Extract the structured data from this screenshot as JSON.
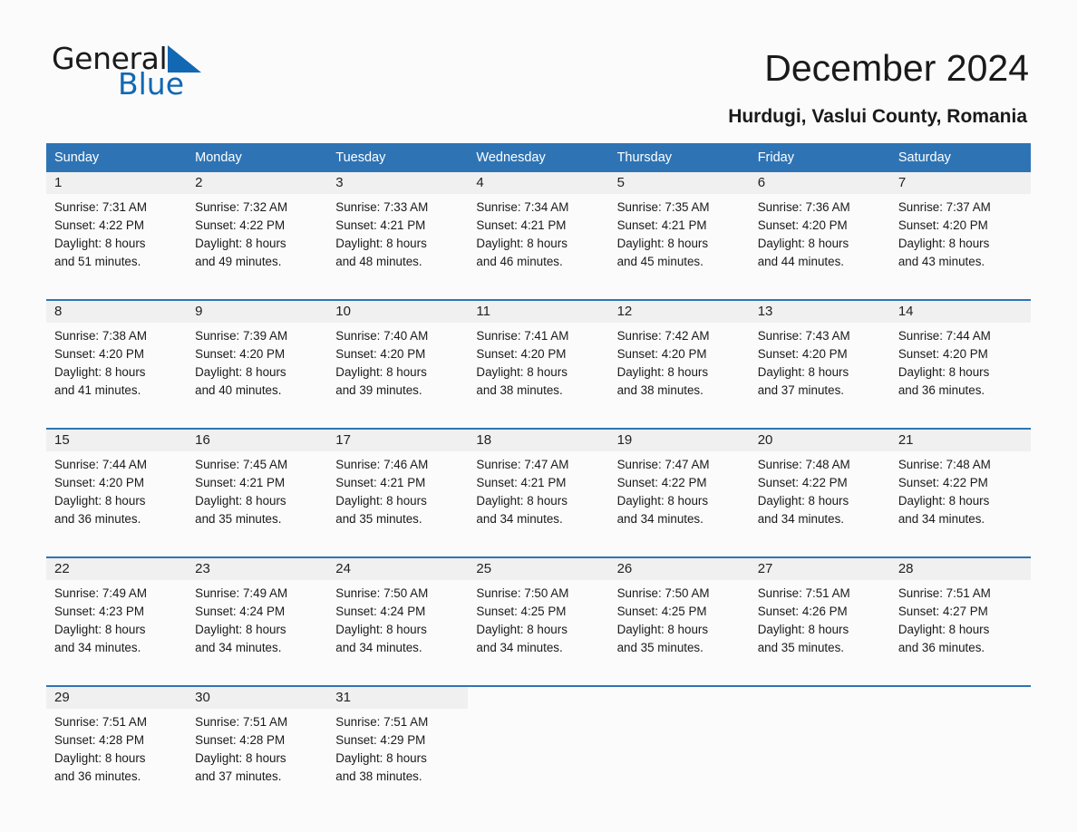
{
  "brand": {
    "name_part1": "General",
    "name_part2": "Blue",
    "triangle_color": "#1268b3"
  },
  "header": {
    "title": "December 2024",
    "location": "Hurdugi, Vaslui County, Romania",
    "header_bg_color": "#2e74b5",
    "daynum_bg_color": "#f0f0f0"
  },
  "calendar": {
    "weekday_headers": [
      "Sunday",
      "Monday",
      "Tuesday",
      "Wednesday",
      "Thursday",
      "Friday",
      "Saturday"
    ],
    "weeks": [
      [
        {
          "day": "1",
          "sunrise": "Sunrise: 7:31 AM",
          "sunset": "Sunset: 4:22 PM",
          "daylight1": "Daylight: 8 hours",
          "daylight2": "and 51 minutes."
        },
        {
          "day": "2",
          "sunrise": "Sunrise: 7:32 AM",
          "sunset": "Sunset: 4:22 PM",
          "daylight1": "Daylight: 8 hours",
          "daylight2": "and 49 minutes."
        },
        {
          "day": "3",
          "sunrise": "Sunrise: 7:33 AM",
          "sunset": "Sunset: 4:21 PM",
          "daylight1": "Daylight: 8 hours",
          "daylight2": "and 48 minutes."
        },
        {
          "day": "4",
          "sunrise": "Sunrise: 7:34 AM",
          "sunset": "Sunset: 4:21 PM",
          "daylight1": "Daylight: 8 hours",
          "daylight2": "and 46 minutes."
        },
        {
          "day": "5",
          "sunrise": "Sunrise: 7:35 AM",
          "sunset": "Sunset: 4:21 PM",
          "daylight1": "Daylight: 8 hours",
          "daylight2": "and 45 minutes."
        },
        {
          "day": "6",
          "sunrise": "Sunrise: 7:36 AM",
          "sunset": "Sunset: 4:20 PM",
          "daylight1": "Daylight: 8 hours",
          "daylight2": "and 44 minutes."
        },
        {
          "day": "7",
          "sunrise": "Sunrise: 7:37 AM",
          "sunset": "Sunset: 4:20 PM",
          "daylight1": "Daylight: 8 hours",
          "daylight2": "and 43 minutes."
        }
      ],
      [
        {
          "day": "8",
          "sunrise": "Sunrise: 7:38 AM",
          "sunset": "Sunset: 4:20 PM",
          "daylight1": "Daylight: 8 hours",
          "daylight2": "and 41 minutes."
        },
        {
          "day": "9",
          "sunrise": "Sunrise: 7:39 AM",
          "sunset": "Sunset: 4:20 PM",
          "daylight1": "Daylight: 8 hours",
          "daylight2": "and 40 minutes."
        },
        {
          "day": "10",
          "sunrise": "Sunrise: 7:40 AM",
          "sunset": "Sunset: 4:20 PM",
          "daylight1": "Daylight: 8 hours",
          "daylight2": "and 39 minutes."
        },
        {
          "day": "11",
          "sunrise": "Sunrise: 7:41 AM",
          "sunset": "Sunset: 4:20 PM",
          "daylight1": "Daylight: 8 hours",
          "daylight2": "and 38 minutes."
        },
        {
          "day": "12",
          "sunrise": "Sunrise: 7:42 AM",
          "sunset": "Sunset: 4:20 PM",
          "daylight1": "Daylight: 8 hours",
          "daylight2": "and 38 minutes."
        },
        {
          "day": "13",
          "sunrise": "Sunrise: 7:43 AM",
          "sunset": "Sunset: 4:20 PM",
          "daylight1": "Daylight: 8 hours",
          "daylight2": "and 37 minutes."
        },
        {
          "day": "14",
          "sunrise": "Sunrise: 7:44 AM",
          "sunset": "Sunset: 4:20 PM",
          "daylight1": "Daylight: 8 hours",
          "daylight2": "and 36 minutes."
        }
      ],
      [
        {
          "day": "15",
          "sunrise": "Sunrise: 7:44 AM",
          "sunset": "Sunset: 4:20 PM",
          "daylight1": "Daylight: 8 hours",
          "daylight2": "and 36 minutes."
        },
        {
          "day": "16",
          "sunrise": "Sunrise: 7:45 AM",
          "sunset": "Sunset: 4:21 PM",
          "daylight1": "Daylight: 8 hours",
          "daylight2": "and 35 minutes."
        },
        {
          "day": "17",
          "sunrise": "Sunrise: 7:46 AM",
          "sunset": "Sunset: 4:21 PM",
          "daylight1": "Daylight: 8 hours",
          "daylight2": "and 35 minutes."
        },
        {
          "day": "18",
          "sunrise": "Sunrise: 7:47 AM",
          "sunset": "Sunset: 4:21 PM",
          "daylight1": "Daylight: 8 hours",
          "daylight2": "and 34 minutes."
        },
        {
          "day": "19",
          "sunrise": "Sunrise: 7:47 AM",
          "sunset": "Sunset: 4:22 PM",
          "daylight1": "Daylight: 8 hours",
          "daylight2": "and 34 minutes."
        },
        {
          "day": "20",
          "sunrise": "Sunrise: 7:48 AM",
          "sunset": "Sunset: 4:22 PM",
          "daylight1": "Daylight: 8 hours",
          "daylight2": "and 34 minutes."
        },
        {
          "day": "21",
          "sunrise": "Sunrise: 7:48 AM",
          "sunset": "Sunset: 4:22 PM",
          "daylight1": "Daylight: 8 hours",
          "daylight2": "and 34 minutes."
        }
      ],
      [
        {
          "day": "22",
          "sunrise": "Sunrise: 7:49 AM",
          "sunset": "Sunset: 4:23 PM",
          "daylight1": "Daylight: 8 hours",
          "daylight2": "and 34 minutes."
        },
        {
          "day": "23",
          "sunrise": "Sunrise: 7:49 AM",
          "sunset": "Sunset: 4:24 PM",
          "daylight1": "Daylight: 8 hours",
          "daylight2": "and 34 minutes."
        },
        {
          "day": "24",
          "sunrise": "Sunrise: 7:50 AM",
          "sunset": "Sunset: 4:24 PM",
          "daylight1": "Daylight: 8 hours",
          "daylight2": "and 34 minutes."
        },
        {
          "day": "25",
          "sunrise": "Sunrise: 7:50 AM",
          "sunset": "Sunset: 4:25 PM",
          "daylight1": "Daylight: 8 hours",
          "daylight2": "and 34 minutes."
        },
        {
          "day": "26",
          "sunrise": "Sunrise: 7:50 AM",
          "sunset": "Sunset: 4:25 PM",
          "daylight1": "Daylight: 8 hours",
          "daylight2": "and 35 minutes."
        },
        {
          "day": "27",
          "sunrise": "Sunrise: 7:51 AM",
          "sunset": "Sunset: 4:26 PM",
          "daylight1": "Daylight: 8 hours",
          "daylight2": "and 35 minutes."
        },
        {
          "day": "28",
          "sunrise": "Sunrise: 7:51 AM",
          "sunset": "Sunset: 4:27 PM",
          "daylight1": "Daylight: 8 hours",
          "daylight2": "and 36 minutes."
        }
      ],
      [
        {
          "day": "29",
          "sunrise": "Sunrise: 7:51 AM",
          "sunset": "Sunset: 4:28 PM",
          "daylight1": "Daylight: 8 hours",
          "daylight2": "and 36 minutes."
        },
        {
          "day": "30",
          "sunrise": "Sunrise: 7:51 AM",
          "sunset": "Sunset: 4:28 PM",
          "daylight1": "Daylight: 8 hours",
          "daylight2": "and 37 minutes."
        },
        {
          "day": "31",
          "sunrise": "Sunrise: 7:51 AM",
          "sunset": "Sunset: 4:29 PM",
          "daylight1": "Daylight: 8 hours",
          "daylight2": "and 38 minutes."
        },
        {
          "day": "",
          "sunrise": "",
          "sunset": "",
          "daylight1": "",
          "daylight2": ""
        },
        {
          "day": "",
          "sunrise": "",
          "sunset": "",
          "daylight1": "",
          "daylight2": ""
        },
        {
          "day": "",
          "sunrise": "",
          "sunset": "",
          "daylight1": "",
          "daylight2": ""
        },
        {
          "day": "",
          "sunrise": "",
          "sunset": "",
          "daylight1": "",
          "daylight2": ""
        }
      ]
    ]
  }
}
